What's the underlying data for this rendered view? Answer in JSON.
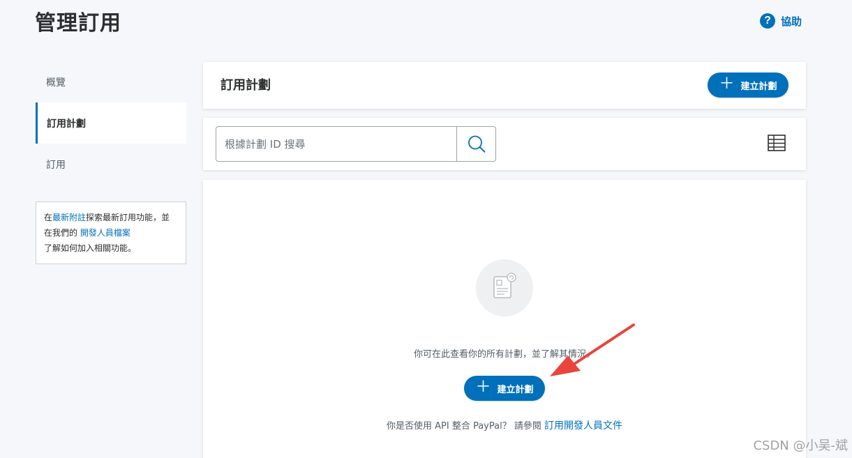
{
  "header": {
    "title": "管理訂用",
    "help_icon_glyph": "?",
    "help_label": "協助"
  },
  "sidebar": {
    "items": [
      {
        "label": "概覽"
      },
      {
        "label": "訂用計劃"
      },
      {
        "label": "訂用"
      }
    ],
    "notice": {
      "prefix": "在",
      "link1": "最新附註",
      "middle": "探索最新訂用功能，並在我們的 ",
      "link2": "開發人員檔案",
      "suffix": "了解如何加入相關功能。"
    }
  },
  "plans_card": {
    "title": "訂用計劃",
    "create_label": "建立計劃"
  },
  "search": {
    "placeholder": "根據計劃 ID 搜尋"
  },
  "empty_state": {
    "message": "你可在此查看你的所有計劃，並了解其情況。",
    "create_label": "建立計劃",
    "api_text": "你是否使用 API 整合 PayPal？ 請參閱 ",
    "api_link": "訂用開發人員文件"
  },
  "watermark": "CSDN @小吴-斌",
  "colors": {
    "accent": "#0070ba",
    "arrow": "#e8453c",
    "background": "#f5f7fa"
  },
  "icons": [
    "help-icon",
    "plus-icon",
    "search-icon",
    "table-view-icon",
    "document-icon",
    "annotation-arrow"
  ]
}
